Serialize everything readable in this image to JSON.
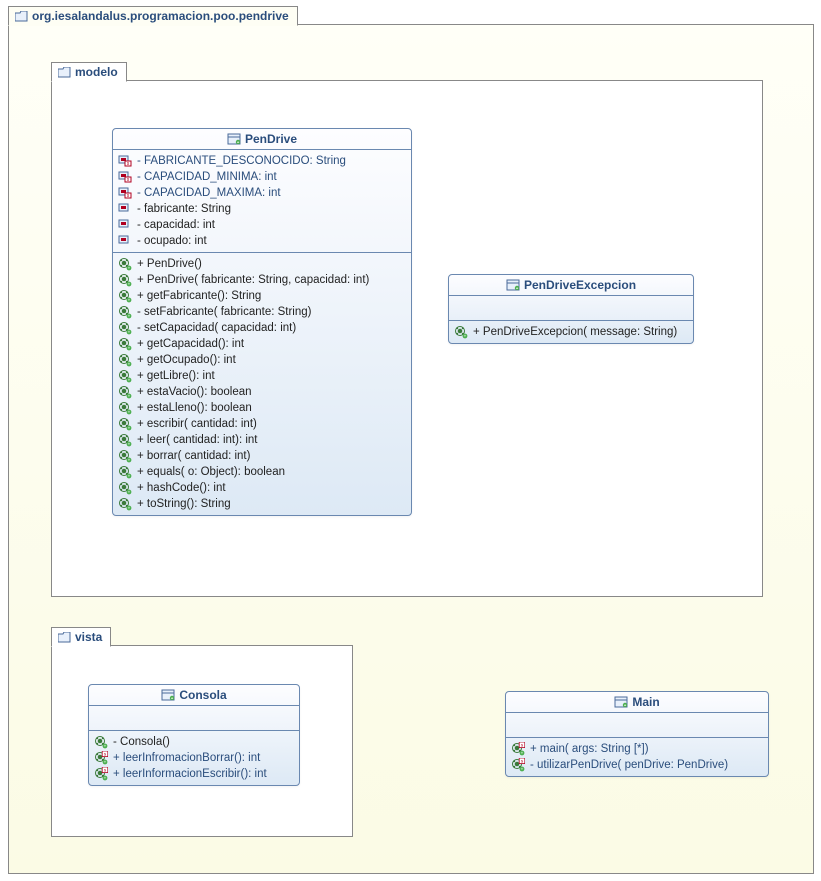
{
  "packages": {
    "outer": "org.iesalandalus.programacion.poo.pendrive",
    "modelo": "modelo",
    "vista": "vista"
  },
  "classes": {
    "pendrive": {
      "name": "PenDrive",
      "fields": [
        {
          "k": "sf",
          "t": "- FABRICANTE_DESCONOCIDO: String"
        },
        {
          "k": "sf",
          "t": "- CAPACIDAD_MINIMA: int"
        },
        {
          "k": "sf",
          "t": "- CAPACIDAD_MAXIMA: int"
        },
        {
          "k": "f",
          "t": "- fabricante: String"
        },
        {
          "k": "f",
          "t": "- capacidad: int"
        },
        {
          "k": "f",
          "t": "- ocupado: int"
        }
      ],
      "methods": [
        {
          "k": "m",
          "t": "+ PenDrive()"
        },
        {
          "k": "m",
          "t": "+ PenDrive(  fabricante: String,   capacidad: int)"
        },
        {
          "k": "m",
          "t": "+ getFabricante(): String"
        },
        {
          "k": "m",
          "t": "- setFabricante(  fabricante: String)"
        },
        {
          "k": "m",
          "t": "- setCapacidad(  capacidad: int)"
        },
        {
          "k": "m",
          "t": "+ getCapacidad(): int"
        },
        {
          "k": "m",
          "t": "+ getOcupado(): int"
        },
        {
          "k": "m",
          "t": "+ getLibre(): int"
        },
        {
          "k": "m",
          "t": "+ estaVacio(): boolean"
        },
        {
          "k": "m",
          "t": "+ estaLleno(): boolean"
        },
        {
          "k": "m",
          "t": "+ escribir(  cantidad: int)"
        },
        {
          "k": "m",
          "t": "+ leer(  cantidad: int): int"
        },
        {
          "k": "m",
          "t": "+ borrar(  cantidad: int)"
        },
        {
          "k": "m",
          "t": "+ equals(  o: Object): boolean"
        },
        {
          "k": "m",
          "t": "+ hashCode(): int"
        },
        {
          "k": "m",
          "t": "+ toString(): String"
        }
      ]
    },
    "exception": {
      "name": "PenDriveExcepcion",
      "methods": [
        {
          "k": "m",
          "t": "+ PenDriveExcepcion(  message: String)"
        }
      ]
    },
    "consola": {
      "name": "Consola",
      "methods": [
        {
          "k": "m",
          "t": "- Consola()"
        },
        {
          "k": "sm",
          "t": "+ leerInfromacionBorrar(): int"
        },
        {
          "k": "sm",
          "t": "+ leerInformacionEscribir(): int"
        }
      ]
    },
    "main": {
      "name": "Main",
      "methods": [
        {
          "k": "sm",
          "t": "+ main(  args: String [*])"
        },
        {
          "k": "sm",
          "t": "- utilizarPenDrive(  penDrive: PenDrive)"
        }
      ]
    }
  }
}
